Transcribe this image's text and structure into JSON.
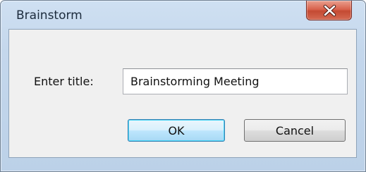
{
  "window": {
    "title": "Brainstorm"
  },
  "icons": {
    "close": "close-icon"
  },
  "form": {
    "label": "Enter title:",
    "title_value": "Brainstorming Meeting"
  },
  "buttons": {
    "ok_label": "OK",
    "cancel_label": "Cancel"
  },
  "colors": {
    "frame": "#c4d7ec",
    "close_button": "#d8634d",
    "client": "#f0f0f0",
    "default_button_border": "#3c7fb1"
  }
}
